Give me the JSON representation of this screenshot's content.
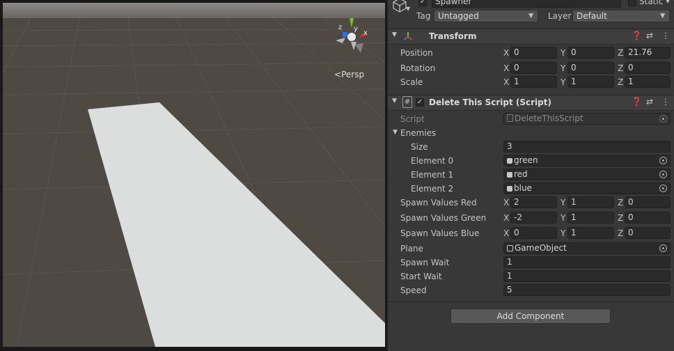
{
  "scene": {
    "persp_label": "Persp",
    "gizmo_labels": {
      "z": "z",
      "x": "x",
      "y": "y"
    }
  },
  "object": {
    "name": "Spawner",
    "static_label": "Static",
    "tag_label": "Tag",
    "tag_value": "Untagged",
    "layer_label": "Layer",
    "layer_value": "Default"
  },
  "transform": {
    "title": "Transform",
    "rows": [
      {
        "label": "Position",
        "x": "0",
        "y": "0",
        "z": "21.76"
      },
      {
        "label": "Rotation",
        "x": "0",
        "y": "0",
        "z": "0"
      },
      {
        "label": "Scale",
        "x": "1",
        "y": "1",
        "z": "1"
      }
    ]
  },
  "axis": {
    "x": "X",
    "y": "Y",
    "z": "Z"
  },
  "script_component": {
    "title": "Delete This Script (Script)",
    "script_label": "Script",
    "script_value": "DeleteThisScript",
    "enemies_label": "Enemies",
    "size_label": "Size",
    "size_value": "3",
    "elements": [
      {
        "label": "Element 0",
        "value": "green"
      },
      {
        "label": "Element 1",
        "value": "red"
      },
      {
        "label": "Element 2",
        "value": "blue"
      }
    ],
    "vectors": [
      {
        "label": "Spawn Values Red",
        "x": "2",
        "y": "1",
        "z": "0"
      },
      {
        "label": "Spawn Values Green",
        "x": "-2",
        "y": "1",
        "z": "0"
      },
      {
        "label": "Spawn Values Blue",
        "x": "0",
        "y": "1",
        "z": "0"
      }
    ],
    "plane_label": "Plane",
    "plane_value": "GameObject",
    "spawn_wait_label": "Spawn Wait",
    "spawn_wait_value": "1",
    "start_wait_label": "Start Wait",
    "start_wait_value": "1",
    "speed_label": "Speed",
    "speed_value": "5"
  },
  "add_component_label": "Add Component"
}
